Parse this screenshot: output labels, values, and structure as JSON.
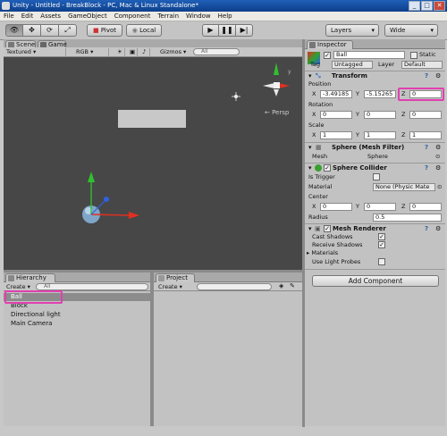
{
  "window": {
    "title": "Unity - Untitled - BreakBlock - PC, Mac & Linux Standalone*",
    "min": "_",
    "max": "□",
    "close": "✕"
  },
  "menu": [
    "File",
    "Edit",
    "Assets",
    "GameObject",
    "Component",
    "Terrain",
    "Window",
    "Help"
  ],
  "toolbar": {
    "pivot": "Pivot",
    "local": "Local",
    "play": "▶",
    "pause": "❚❚",
    "step": "▶|",
    "layers": "Layers",
    "layout": "Wide",
    "tools": [
      "👁",
      "✥",
      "⟳",
      "⤢"
    ]
  },
  "scene": {
    "tab_scene": "Scene",
    "tab_game": "Game",
    "shading": "Textured",
    "render_mode": "RGB",
    "gizmos": "Gizmos ▾",
    "search_placeholder": "All",
    "persp": "← Persp",
    "gizmo_y": "y"
  },
  "hierarchy": {
    "title": "Hierarchy",
    "create": "Create ▾",
    "search": "All",
    "items": [
      "Ball",
      "Block",
      "Directional light",
      "Main Camera"
    ]
  },
  "project": {
    "title": "Project",
    "create": "Create ▾"
  },
  "inspector": {
    "title": "Inspector",
    "name": "Ball",
    "static": "Static",
    "tag_label": "Tag",
    "tag": "Untagged",
    "layer_label": "Layer",
    "layer": "Default",
    "transform": {
      "title": "Transform",
      "position": "Position",
      "rotation": "Rotation",
      "scale": "Scale",
      "pos": {
        "x": "-3.49185",
        "y": "-5.15265",
        "z": "0"
      },
      "rot": {
        "x": "0",
        "y": "0",
        "z": "0"
      },
      "scl": {
        "x": "1",
        "y": "1",
        "z": "1"
      }
    },
    "mesh_filter": {
      "title": "Sphere (Mesh Filter)",
      "mesh_label": "Mesh",
      "mesh": "Sphere"
    },
    "collider": {
      "title": "Sphere Collider",
      "is_trigger": "Is Trigger",
      "material_label": "Material",
      "material": "None (Physic Mate",
      "center": "Center",
      "cx": "0",
      "cy": "0",
      "cz": "0",
      "radius_label": "Radius",
      "radius": "0.5"
    },
    "renderer": {
      "title": "Mesh Renderer",
      "cast": "Cast Shadows",
      "receive": "Receive Shadows",
      "materials": "Materials",
      "probes": "Use Light Probes"
    },
    "add_component": "Add Component"
  },
  "colors": {
    "highlight": "#e040b0",
    "scene_bg": "#474747",
    "x_axis": "#e03020",
    "y_axis": "#30c030",
    "z_axis": "#3060e0"
  }
}
